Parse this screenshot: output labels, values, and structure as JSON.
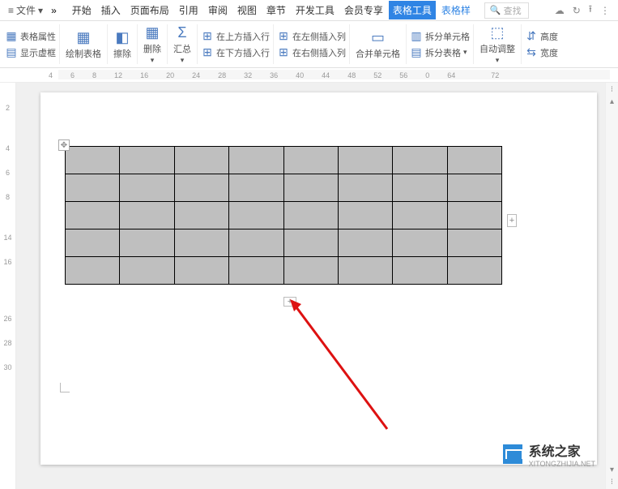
{
  "menubar": {
    "file": "文件",
    "chevron1": "»",
    "chevron2": "»"
  },
  "tabs": {
    "items": [
      "开始",
      "插入",
      "页面布局",
      "引用",
      "审阅",
      "视图",
      "章节",
      "开发工具",
      "会员专享",
      "表格工具",
      "表格样"
    ],
    "active_index": 9
  },
  "search_placeholder": "查找",
  "ribbon": {
    "g1": {
      "props": "表格属性",
      "showGrid": "显示虚框"
    },
    "g2": {
      "draw": "绘制表格",
      "erase": "擦除"
    },
    "g3": {
      "delete": "删除"
    },
    "g4": {
      "sum": "汇总"
    },
    "g5": {
      "insertAbove": "在上方插入行",
      "insertBelow": "在下方插入行",
      "insertLeft": "在左侧插入列",
      "insertRight": "在右侧插入列"
    },
    "g6": {
      "merge": "合并单元格"
    },
    "g7": {
      "splitCell": "拆分单元格",
      "splitTable": "拆分表格"
    },
    "g8": {
      "autofit": "自动调整"
    },
    "g9": {
      "height": "高度",
      "width": "宽度"
    }
  },
  "hruler_marks": [
    4,
    6,
    8,
    12,
    16,
    20,
    24,
    28,
    32,
    36,
    40,
    44,
    48,
    52,
    56,
    "0",
    "64",
    "",
    "72"
  ],
  "vruler_marks": [
    "",
    "2",
    "",
    "4",
    "6",
    "8",
    "",
    "14",
    "16",
    "",
    "",
    "26",
    "28",
    "30"
  ],
  "table": {
    "rows": 5,
    "cols": 8
  },
  "add_symbol": "+",
  "move_symbol": "✥",
  "watermark": {
    "title": "系统之家",
    "sub": "XITONGZHIJIA.NET"
  },
  "scroll": {
    "up": "▴",
    "down": "▾",
    "dots": "⁝"
  }
}
